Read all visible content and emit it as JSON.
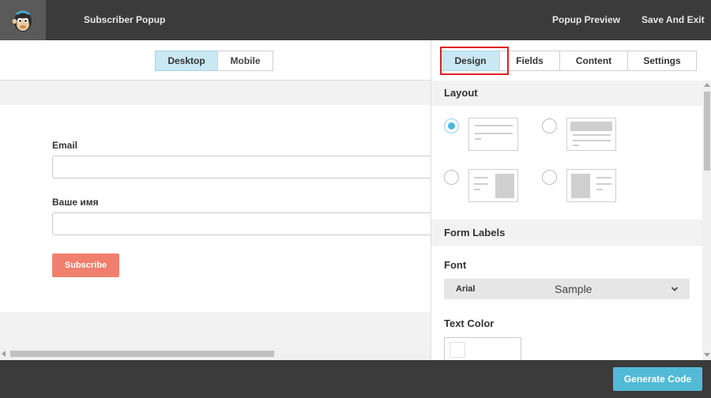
{
  "header": {
    "logo_icon": "monkey-logo-icon",
    "title": "Subscriber Popup",
    "preview_label": "Popup Preview",
    "save_exit_label": "Save And Exit"
  },
  "view_toggle": {
    "desktop_label": "Desktop",
    "mobile_label": "Mobile",
    "selected": "Desktop"
  },
  "form": {
    "email_label": "Email",
    "name_label": "Ваше имя",
    "subscribe_label": "Subscribe"
  },
  "settings": {
    "tabs": [
      {
        "label": "Design",
        "active": true
      },
      {
        "label": "Fields",
        "active": false
      },
      {
        "label": "Content",
        "active": false
      },
      {
        "label": "Settings",
        "active": false
      }
    ],
    "layout": {
      "heading": "Layout",
      "selected_index": 0
    },
    "form_labels": {
      "heading": "Form Labels",
      "font_label": "Font",
      "font_value": "Arial",
      "font_sample": "Sample",
      "text_color_label": "Text Color",
      "text_color_value": "#ffffff"
    }
  },
  "footer": {
    "generate_label": "Generate Code"
  },
  "colors": {
    "accent": "#52bad5",
    "subscribe_button": "#f0806d",
    "active_tab": "#c9e8f3",
    "highlight": "#e02020",
    "topbar": "#3b3b3b"
  }
}
